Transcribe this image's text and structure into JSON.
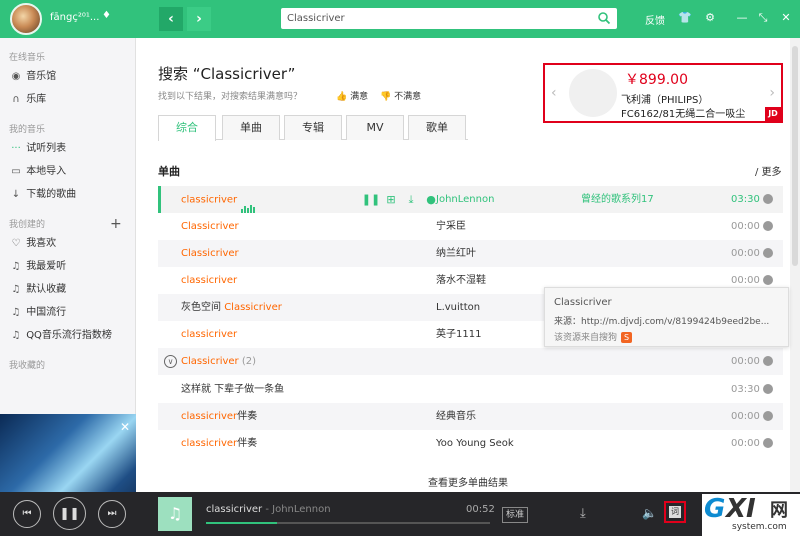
{
  "topbar": {
    "username": "fāngç²⁰¹...",
    "search_value": "Classicriver",
    "feedback": "反馈",
    "back_icon": "chevron-left-icon",
    "forward_icon": "chevron-right-icon"
  },
  "sidebar": {
    "section_online": "在线音乐",
    "music_hall": "音乐馆",
    "radio": "乐库",
    "section_mine": "我的音乐",
    "trial_list": "试听列表",
    "local_import": "本地导入",
    "downloaded": "下载的歌曲",
    "section_created": "我创建的",
    "favorites": "我喜欢",
    "most_played": "我最爱听",
    "default_collection": "默认收藏",
    "china_pop": "中国流行",
    "qq_index": "QQ音乐流行指数榜",
    "section_collected": "我收藏的"
  },
  "main": {
    "title": "搜索 “Classicriver”",
    "satisfy_prompt": "找到以下结果，对搜索结果满意吗？",
    "satisfied": "满意",
    "unsatisfied": "不满意",
    "tabs": [
      "综合",
      "单曲",
      "专辑",
      "MV",
      "歌单"
    ],
    "section_title": "单曲",
    "more": "/ 更多",
    "view_more": "查看更多单曲结果"
  },
  "songs": [
    {
      "pre": "",
      "name": "classicriver",
      "post": "",
      "artist": "JohnLennon",
      "album": "曾经的歌系列17",
      "duration": "03:30"
    },
    {
      "pre": "",
      "name": "Classicriver",
      "post": "",
      "artist": "宁采臣",
      "album": "",
      "duration": "00:00"
    },
    {
      "pre": "",
      "name": "Classicriver",
      "post": "",
      "artist": "纳兰红叶",
      "album": "",
      "duration": "00:00"
    },
    {
      "pre": "",
      "name": "classicriver",
      "post": "",
      "artist": "落水不湿鞋",
      "album": "",
      "duration": "00:00"
    },
    {
      "pre": "灰色空间 ",
      "name": "Classicriver",
      "post": "",
      "artist": "L.vuitton",
      "album": "",
      "duration": ""
    },
    {
      "pre": "",
      "name": "classicriver",
      "post": "",
      "artist": "英子1111",
      "album": "",
      "duration": ""
    },
    {
      "pre": "",
      "name": "Classicriver",
      "post": "",
      "count": "(2)",
      "artist": "",
      "album": "",
      "duration": "00:00"
    },
    {
      "pre": "这样就 下辈子做一条鱼",
      "name": "",
      "post": "",
      "artist": "",
      "album": "",
      "duration": "03:30"
    },
    {
      "pre": "",
      "name": "classicriver",
      "post": "伴奏",
      "artist": "经典音乐",
      "album": "",
      "duration": "00:00"
    },
    {
      "pre": "",
      "name": "classicriver",
      "post": "伴奏",
      "artist": "Yoo Young Seok",
      "album": "",
      "duration": "00:00"
    }
  ],
  "ad": {
    "price": "￥899.00",
    "line1": "飞利浦（PHILIPS）",
    "line2": "FC6162/81无绳二合一吸尘",
    "badge": "JD"
  },
  "tooltip": {
    "title": "Classicriver",
    "source": "来源：http://m.djvdj.com/v/8199424b9eed2be...",
    "note": "该资源来自搜狗",
    "badge": "S"
  },
  "player": {
    "song": "classicriver",
    "separator": " - ",
    "artist": "JohnLennon",
    "time": "00:52",
    "quality": "标准",
    "progress": 0.25,
    "lyric_label": "词"
  },
  "watermark": {
    "g": "G",
    "xi": "XI",
    "wang": "网",
    "site": "system.com"
  }
}
